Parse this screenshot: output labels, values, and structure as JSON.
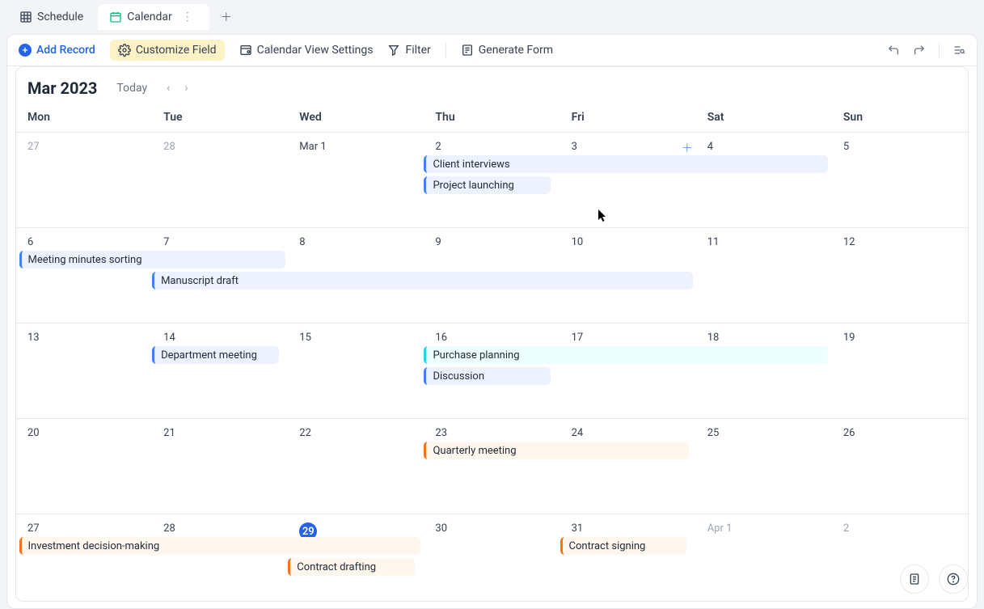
{
  "tabs": {
    "schedule": "Schedule",
    "calendar": "Calendar"
  },
  "toolbar": {
    "add_record": "Add Record",
    "customize_field": "Customize Field",
    "view_settings": "Calendar View Settings",
    "filter": "Filter",
    "generate_form": "Generate Form"
  },
  "calendar": {
    "title": "Mar 2023",
    "today_label": "Today",
    "dow": {
      "mon": "Mon",
      "tue": "Tue",
      "wed": "Wed",
      "thu": "Thu",
      "fri": "Fri",
      "sat": "Sat",
      "sun": "Sun"
    },
    "weeks": [
      {
        "days": [
          "27",
          "28",
          "Mar 1",
          "2",
          "3",
          "4",
          "5"
        ],
        "faded": [
          0,
          1
        ]
      },
      {
        "days": [
          "6",
          "7",
          "8",
          "9",
          "10",
          "11",
          "12"
        ]
      },
      {
        "days": [
          "13",
          "14",
          "15",
          "16",
          "17",
          "18",
          "19"
        ]
      },
      {
        "days": [
          "20",
          "21",
          "22",
          "23",
          "24",
          "25",
          "26"
        ]
      },
      {
        "days": [
          "27",
          "28",
          "29",
          "30",
          "31",
          "Apr 1",
          "2"
        ],
        "faded": [
          5,
          6
        ],
        "today_idx": 2
      }
    ]
  },
  "events": {
    "w0": {
      "client_interviews": "Client interviews",
      "project_launching": "Project launching"
    },
    "w1": {
      "meeting_minutes": "Meeting minutes sorting",
      "manuscript_draft": "Manuscript draft"
    },
    "w2": {
      "dept_meeting": "Department meeting",
      "purchase_planning": "Purchase planning",
      "discussion": "Discussion"
    },
    "w3": {
      "quarterly_meeting": "Quarterly meeting"
    },
    "w4": {
      "investment": "Investment decision-making",
      "contract_drafting": "Contract drafting",
      "contract_signing": "Contract signing"
    }
  }
}
